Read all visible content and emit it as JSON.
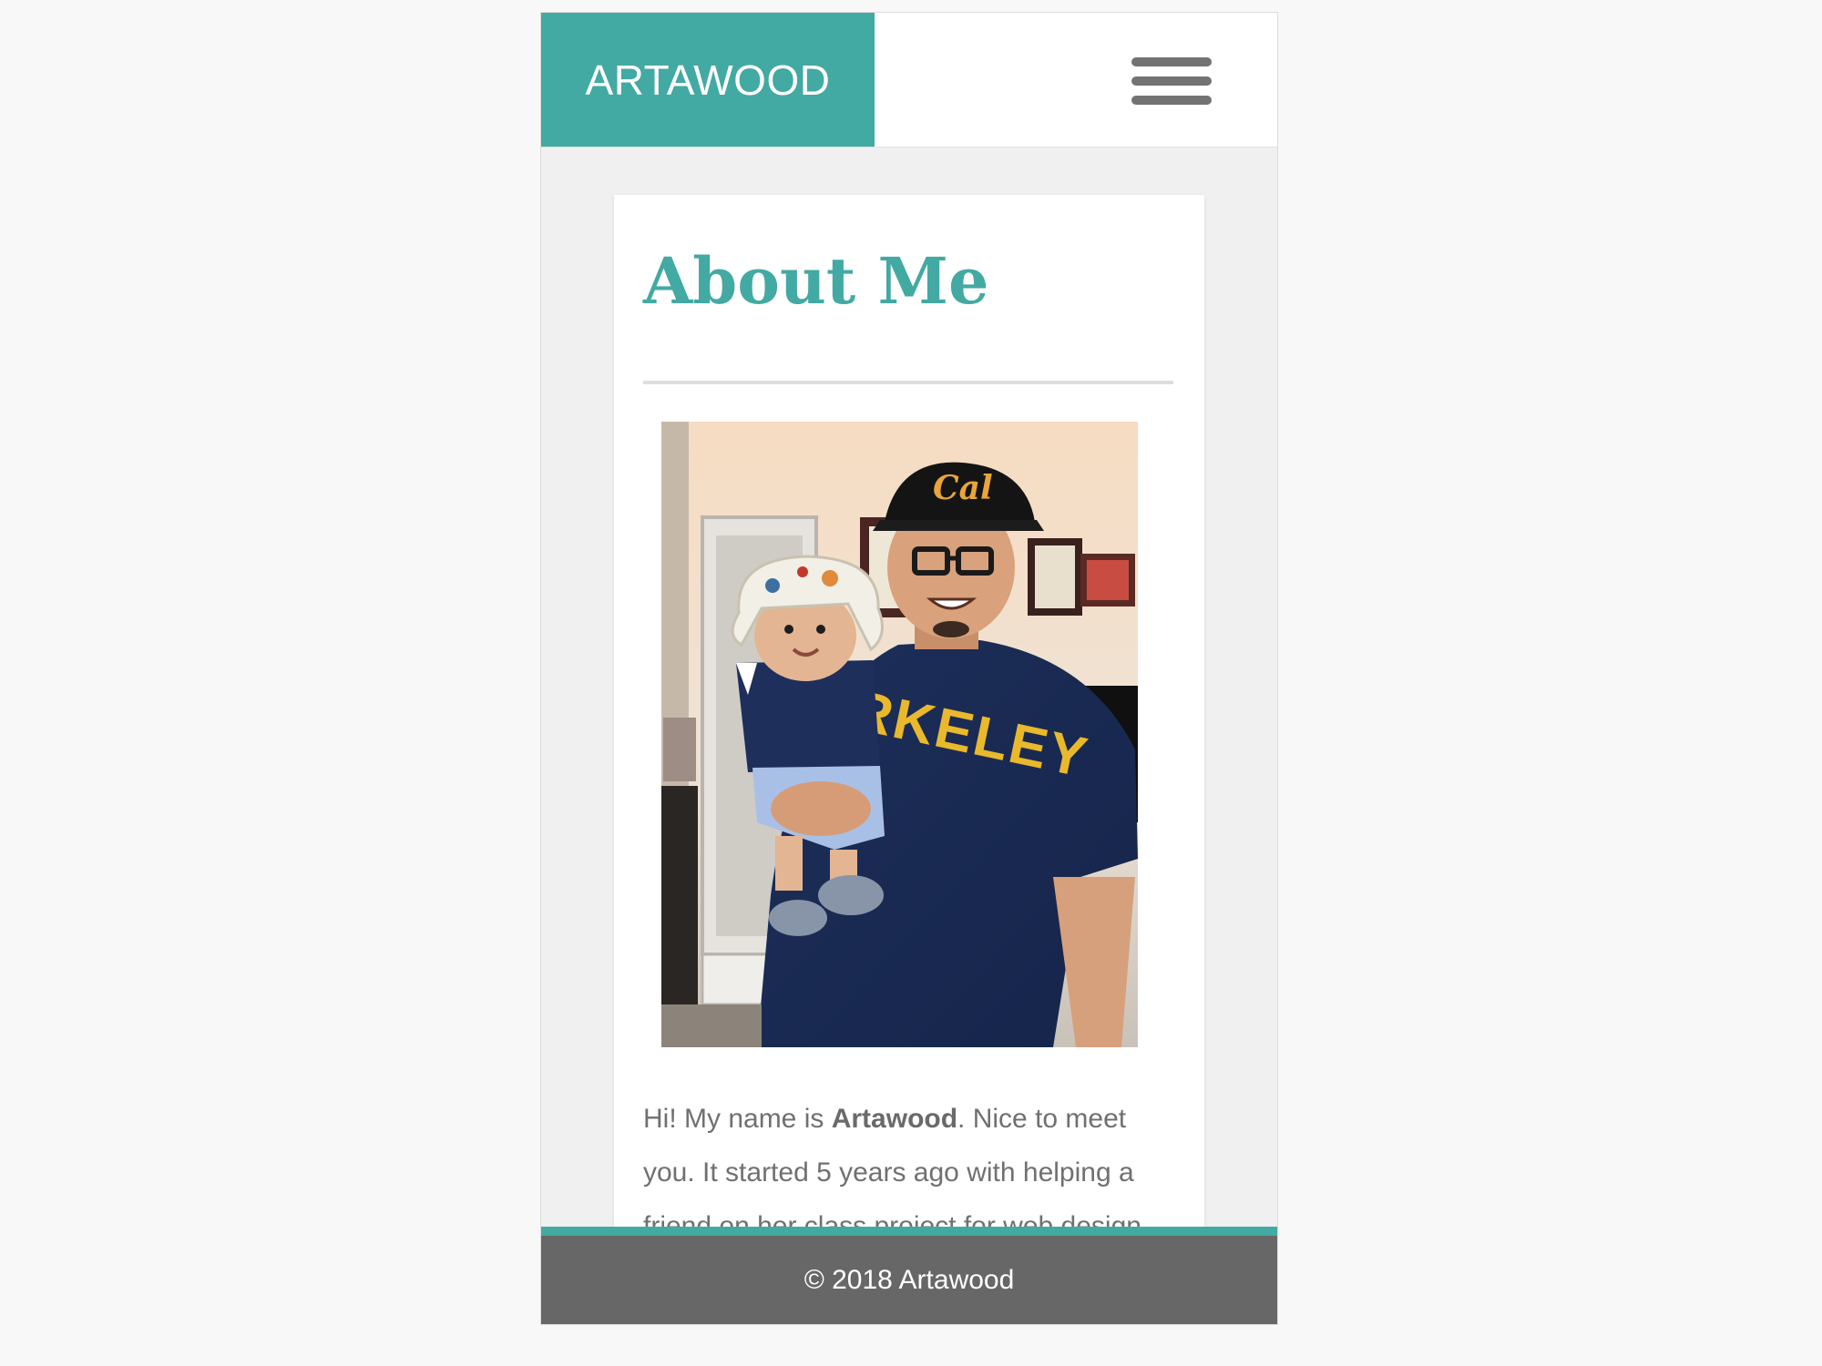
{
  "header": {
    "brand": "ARTAWOOD",
    "menu_icon": "hamburger-menu-icon"
  },
  "main": {
    "title": "About Me",
    "photo_alt": "Artawood holding a baby",
    "bio": {
      "before": "Hi! My name is ",
      "name": "Artawood",
      "after": ". Nice to meet you. It started 5 years ago with helping a friend on her class project for web design"
    }
  },
  "footer": {
    "text": "© 2018 Artawood"
  },
  "colors": {
    "accent": "#43a9a3",
    "footer_bg": "#676767",
    "page_bg": "#f0f0f0"
  }
}
